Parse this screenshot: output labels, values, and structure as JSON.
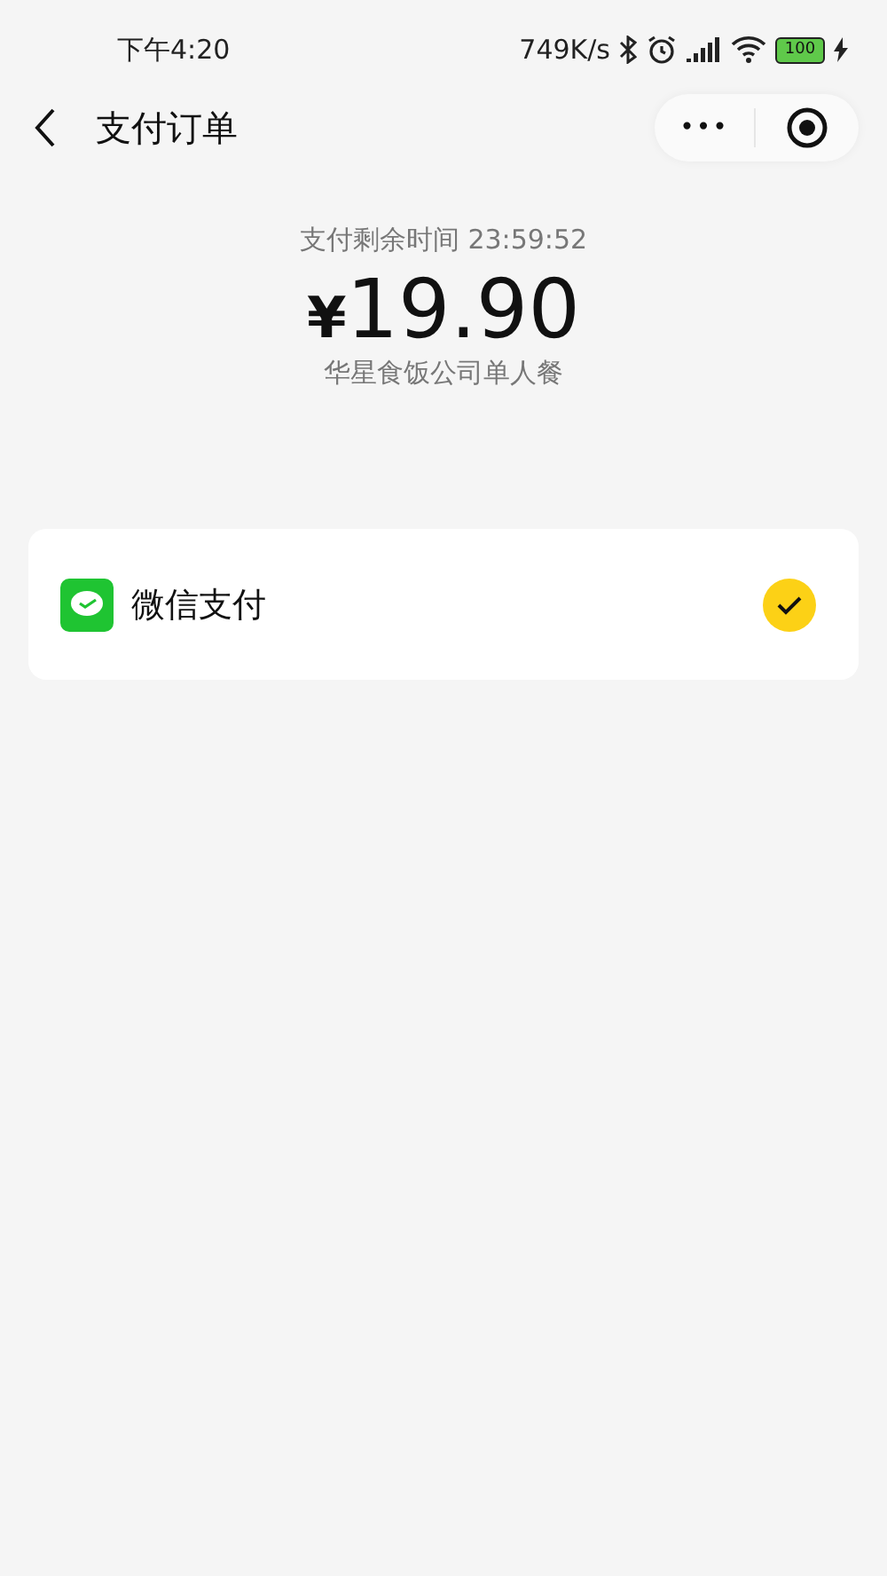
{
  "status_bar": {
    "time": "下午4:20",
    "speed": "749K/s",
    "battery": "100"
  },
  "nav": {
    "title": "支付订单",
    "more": "•••"
  },
  "order": {
    "countdown": "支付剩余时间 23:59:52",
    "currency": "¥",
    "amount": "19.90",
    "merchant": "华星食饭公司单人餐"
  },
  "payment_methods": [
    {
      "label": "微信支付",
      "selected": true
    }
  ]
}
